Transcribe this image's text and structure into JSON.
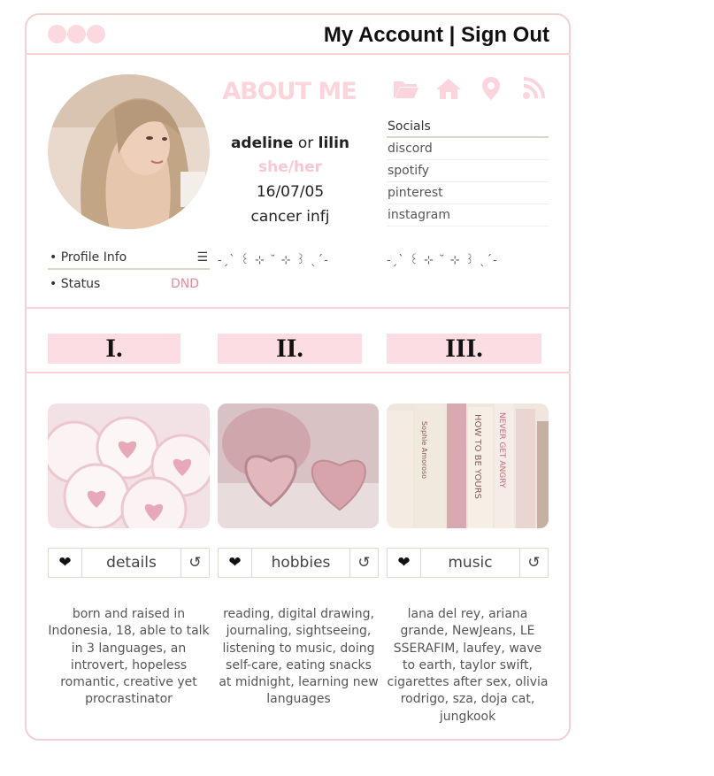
{
  "window": {
    "dot_color": "#fcd9df",
    "nav_text": "My Account | Sign Out"
  },
  "profile": {
    "avatar_alt": "profile photo",
    "about_title": "ABOUT ME",
    "name_first": "adeline",
    "name_connector": "or",
    "name_second": "lilin",
    "pronouns": "she/her",
    "birthday": "16/07/05",
    "traits": "cancer infj"
  },
  "icons": [
    "folder-icon",
    "home-icon",
    "location-icon",
    "rss-icon"
  ],
  "socials": {
    "heading": "Socials",
    "links": [
      "discord",
      "spotify",
      "pinterest",
      "instagram"
    ]
  },
  "profile_info": {
    "label": "• Profile Info",
    "menu_glyph": "☰",
    "status_label": "• Status",
    "status_value": "DND"
  },
  "decorations": [
    "-ˏˋ ꒰ ⊹ ˘ ⊹ ꒱ ˎˊ-",
    "-ˏˋ ꒰ ⊹ ˘ ⊹ ꒱ ˎˊ-"
  ],
  "sections": [
    {
      "numeral": "I.",
      "label": "details",
      "heart": "❤",
      "refresh": "↺",
      "text": "born and raised in Indonesia, 18, able to talk in 3 languages, an introvert, hopeless romantic, creative yet procrastinator"
    },
    {
      "numeral": "II.",
      "label": "hobbies",
      "heart": "❤",
      "refresh": "↺",
      "text": "reading, digital drawing, journaling, sightseeing, listening to music, doing self-care, eating snacks at midnight, learning new languages"
    },
    {
      "numeral": "III.",
      "label": "music",
      "heart": "❤",
      "refresh": "↺",
      "text": "lana del rey, ariana grande, NewJeans, LE SSERAFIM, laufey, wave to earth, taylor swift, cigarettes after sex, olivia rodrigo, sza, doja cat, jungkook"
    }
  ],
  "colors": {
    "accent_pink": "#fcd5dc",
    "border_pink": "#f3cfd2",
    "dnd_red": "#e98a9a"
  }
}
